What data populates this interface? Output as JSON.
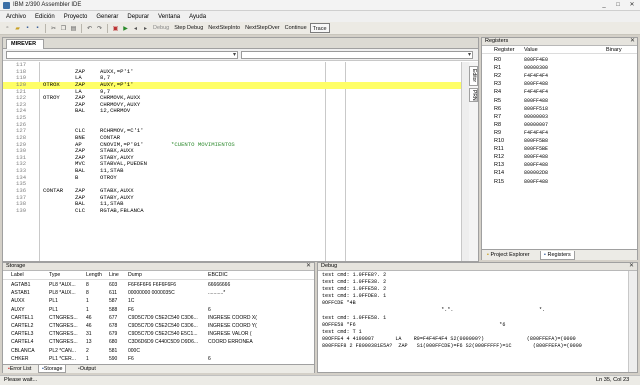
{
  "window": {
    "title": "IBM z/390 Assembler IDE",
    "controls": [
      "_",
      "□",
      "✕"
    ]
  },
  "menu": [
    "Archivo",
    "Edición",
    "Proyecto",
    "Generar",
    "Depurar",
    "Ventana",
    "Ayuda"
  ],
  "toolbar": {
    "icons": [
      "new-file-icon",
      "open-folder-icon",
      "save-icon",
      "save-all-icon",
      "cut-icon",
      "copy-icon",
      "paste-icon",
      "undo-icon",
      "redo-icon",
      "build-icon",
      "run-icon",
      "step-back-icon",
      "step-forward-icon"
    ],
    "buttons": [
      "Debug",
      "Step Debug",
      "NextStepInto",
      "NextStepOver",
      "Continue",
      "Trace"
    ]
  },
  "editor": {
    "tab": "MIREVER",
    "side_tabs": [
      "Editor",
      "PRN"
    ],
    "lines": [
      {
        "n": "117",
        "label": "",
        "op": "",
        "arg": "",
        "comment": ""
      },
      {
        "n": "118",
        "label": "",
        "op": "ZAP",
        "arg": "AUXX,=P'1'",
        "comment": ""
      },
      {
        "n": "119",
        "label": "",
        "op": "LA",
        "arg": "8,7",
        "comment": ""
      },
      {
        "n": "120",
        "label": "OTROX",
        "op": "ZAP",
        "arg": "AUXY,=P'1'",
        "comment": "",
        "hl": true
      },
      {
        "n": "121",
        "label": "",
        "op": "LA",
        "arg": "9,7",
        "comment": ""
      },
      {
        "n": "122",
        "label": "OTROY",
        "op": "ZAP",
        "arg": "CHRMOVK,AUXX",
        "comment": ""
      },
      {
        "n": "123",
        "label": "",
        "op": "ZAP",
        "arg": "CHRMOVY,AUXY",
        "comment": ""
      },
      {
        "n": "124",
        "label": "",
        "op": "BAL",
        "arg": "12,CHRMOV",
        "comment": ""
      },
      {
        "n": "125",
        "label": "",
        "op": "",
        "arg": "",
        "comment": ""
      },
      {
        "n": "126",
        "label": "",
        "op": "",
        "arg": "",
        "comment": ""
      },
      {
        "n": "127",
        "label": "",
        "op": "CLC",
        "arg": "RCHRMOV,=C'1'",
        "comment": ""
      },
      {
        "n": "128",
        "label": "",
        "op": "BNE",
        "arg": "CONTAR",
        "comment": ""
      },
      {
        "n": "129",
        "label": "",
        "op": "AP",
        "arg": "CNOVIM,=P'01'",
        "comment": "*CUENTO MOVIMIENTOS"
      },
      {
        "n": "130",
        "label": "",
        "op": "ZAP",
        "arg": "STABX,AUXX",
        "comment": ""
      },
      {
        "n": "131",
        "label": "",
        "op": "ZAP",
        "arg": "STABY,AUXY",
        "comment": ""
      },
      {
        "n": "132",
        "label": "",
        "op": "MVC",
        "arg": "STABVAL,PUEDEN",
        "comment": ""
      },
      {
        "n": "133",
        "label": "",
        "op": "BAL",
        "arg": "11,STAB",
        "comment": ""
      },
      {
        "n": "134",
        "label": "",
        "op": "B",
        "arg": "OTROY",
        "comment": ""
      },
      {
        "n": "135",
        "label": "",
        "op": "",
        "arg": "",
        "comment": ""
      },
      {
        "n": "136",
        "label": "CONTAR",
        "op": "ZAP",
        "arg": "GTABX,AUXX",
        "comment": ""
      },
      {
        "n": "137",
        "label": "",
        "op": "ZAP",
        "arg": "GTABY,AUXY",
        "comment": ""
      },
      {
        "n": "138",
        "label": "",
        "op": "BAL",
        "arg": "11,STAB",
        "comment": ""
      },
      {
        "n": "139",
        "label": "",
        "op": "CLC",
        "arg": "RGTAB,FBLANCA",
        "comment": ""
      }
    ]
  },
  "registers": {
    "title": "Registers",
    "columns": [
      "Register",
      "Value",
      "Binary"
    ],
    "rows": [
      {
        "name": "R0",
        "value": "800FF4E0"
      },
      {
        "name": "R1",
        "value": "00000300"
      },
      {
        "name": "R2",
        "value": "F4F4F4F4"
      },
      {
        "name": "R3",
        "value": "800FF488"
      },
      {
        "name": "R4",
        "value": "F4F4F4F4"
      },
      {
        "name": "R5",
        "value": "800FF488"
      },
      {
        "name": "R6",
        "value": "800FF518"
      },
      {
        "name": "R7",
        "value": "00000003"
      },
      {
        "name": "R8",
        "value": "00000007"
      },
      {
        "name": "R9",
        "value": "F4F4F4F4"
      },
      {
        "name": "R10",
        "value": "800FF5B8"
      },
      {
        "name": "R11",
        "value": "800FF5BE"
      },
      {
        "name": "R12",
        "value": "800FF488"
      },
      {
        "name": "R13",
        "value": "800FF488"
      },
      {
        "name": "R14",
        "value": "800002D8"
      },
      {
        "name": "R15",
        "value": "800FF488"
      }
    ],
    "tabs": [
      "Project Explorer",
      "Registers"
    ]
  },
  "storage": {
    "title": "Storage",
    "columns": [
      "Label",
      "Type",
      "Length",
      "Line",
      "Dump",
      "EBCDIC"
    ],
    "rows": [
      [
        "AGTAB1",
        "PL8 *AUX...",
        "8",
        "603",
        "F6F6F6F6 F6F6F6F6",
        "66666666"
      ],
      [
        "ASTAB1",
        "PL8 *AUX...",
        "8",
        "611",
        "00000000 0000035C",
        "...........*"
      ],
      [
        "AUXX",
        "PL1",
        "1",
        "587",
        "1C",
        ""
      ],
      [
        "AUXY",
        "PL1",
        "1",
        "588",
        "F6",
        "6"
      ],
      [
        "CARTEL1",
        "CTNGRES...",
        "46",
        "677",
        "C9D5C7D9 C5E2C540 C3D6...",
        "INGRESE COORD X("
      ],
      [
        "CARTEL2",
        "CTNGRES...",
        "46",
        "678",
        "C9D5C7D9 C5E2C540 C3D6...",
        "INGRESE COORD Y("
      ],
      [
        "CARTEL3",
        "CTNGRES...",
        "31",
        "679",
        "C9D5C7D9 C5E2C540 E5C1...",
        "INGRESE VALOR ("
      ],
      [
        "CARTEL4",
        "CTNGRES...",
        "13",
        "680",
        "C3D6D6D9 C440C5D9 D9D6...",
        "COORD ERRONEA"
      ],
      [
        "CBLANCA",
        "PL2 *CAN...",
        "2",
        "581",
        "000C",
        ""
      ],
      [
        "CHKER",
        "PL1 *CER...",
        "1",
        "590",
        "F6",
        "6"
      ]
    ],
    "tabs": [
      "Error List",
      "Storage",
      "Output"
    ]
  },
  "debug": {
    "title": "Debug",
    "lines": [
      "test cmd: 1.0FFE8?. 2",
      "test cmd: 1.0FFE38. 2",
      "test cmd: 1.0FFE58. 2",
      "test cmd: 1.0FFDE8. 1",
      "0OFFCDE *4B                                              ",
      "                                       *.*.                            *.",
      "test cmd: 1.0FFE58. 1",
      "0OFFE58 *F6                                               *6",
      "test cmd: T 1",
      "00OFFE4 4 4190007       LA    R9=F4F4F4F4 S2(000000?)              (800FFEFA)=(0000",
      "800FFEF8 2 F8000381E5A?  ZAP   S1(000FFCDE)=F6 S2(000FFFFF)=1C       (800FFEFA)=(0000"
    ]
  },
  "status": {
    "left": "Please wait...",
    "right": "Ln 35, Col 23"
  }
}
